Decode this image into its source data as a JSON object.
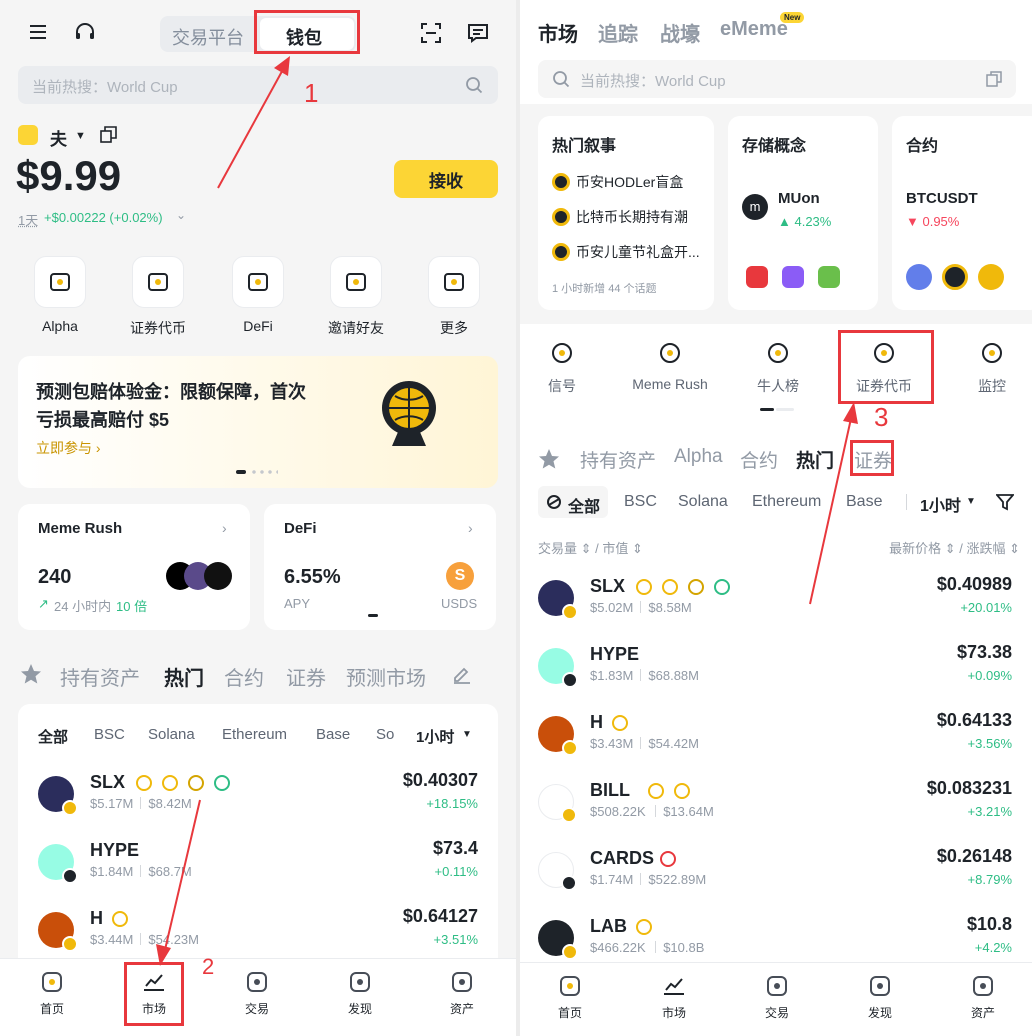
{
  "left": {
    "header": {
      "tab_exchange": "交易平台",
      "tab_wallet": "钱包"
    },
    "search": {
      "placeholder": "当前热搜：World Cup"
    },
    "account": {
      "name": "夫",
      "balance": "$9.99",
      "period": "1天",
      "change": "+$0.00222 (+0.02%)",
      "receive": "接收"
    },
    "shortcuts": [
      {
        "label": "Alpha",
        "icon": "alpha-icon"
      },
      {
        "label": "证券代币",
        "icon": "securities-token-icon"
      },
      {
        "label": "DeFi",
        "icon": "defi-icon"
      },
      {
        "label": "邀请好友",
        "icon": "invite-friends-icon"
      },
      {
        "label": "更多",
        "icon": "more-icon"
      }
    ],
    "banner": {
      "line1": "预测包赔体验金：限额保障，首次",
      "line2": "亏损最高赔付 $5",
      "link": "立即参与 ›"
    },
    "cards": {
      "meme": {
        "title": "Meme Rush",
        "value": "240",
        "sub_prefix": "24 小时内",
        "sub_highlight": "10 倍"
      },
      "defi": {
        "title": "DeFi",
        "value": "6.55%",
        "sub": "APY",
        "token": "USDS"
      }
    },
    "market_tabs": [
      "持有资产",
      "热门",
      "合约",
      "证券",
      "预测市场"
    ],
    "chain_tabs": [
      "全部",
      "BSC",
      "Solana",
      "Ethereum",
      "Base",
      "So"
    ],
    "timeframe": "1小时",
    "tokens": [
      {
        "name": "SLX",
        "vol": "$5.17M",
        "mcap": "$8.42M",
        "price": "$0.40307",
        "change": "+18.15%"
      },
      {
        "name": "HYPE",
        "vol": "$1.84M",
        "mcap": "$68.7M",
        "price": "$73.4",
        "change": "+0.11%"
      },
      {
        "name": "H",
        "vol": "$3.44M",
        "mcap": "$54.23M",
        "price": "$0.64127",
        "change": "+3.51%"
      }
    ],
    "bottom_nav": [
      "首页",
      "市场",
      "交易",
      "发现",
      "资产"
    ],
    "annotations": [
      "1",
      "2"
    ]
  },
  "right": {
    "top_tabs": [
      "市场",
      "追踪",
      "战壕",
      "eMeme"
    ],
    "new_badge": "New",
    "search": {
      "placeholder": "当前热搜：World Cup"
    },
    "cards": {
      "hot": {
        "title": "热门叙事",
        "items": [
          "币安HODLer盲盒",
          "比特币长期持有潮",
          "币安儿童节礼盒开..."
        ],
        "footer": "1 小时新增 44 个话题"
      },
      "storage": {
        "title": "存储概念",
        "token": "MUon",
        "change": "▲ 4.23%"
      },
      "contract": {
        "title": "合约",
        "token": "BTCUSDT",
        "change": "▼ 0.95%"
      }
    },
    "feature_icons": [
      {
        "label": "信号",
        "icon": "signal-icon"
      },
      {
        "label": "Meme Rush",
        "icon": "meme-rush-icon"
      },
      {
        "label": "牛人榜",
        "icon": "leaderboard-icon"
      },
      {
        "label": "证券代币",
        "icon": "securities-token-icon"
      },
      {
        "label": "监控",
        "icon": "monitor-icon"
      }
    ],
    "market_tabs": [
      "持有资产",
      "Alpha",
      "合约",
      "热门",
      "证券"
    ],
    "chain_tabs": [
      "全部",
      "BSC",
      "Solana",
      "Ethereum",
      "Base"
    ],
    "timeframe": "1小时",
    "sort_left": "交易量 ⇕ / 市值 ⇕",
    "sort_right": "最新价格 ⇕ / 涨跌幅 ⇕",
    "tokens": [
      {
        "name": "SLX",
        "vol": "$5.02M",
        "mcap": "$8.58M",
        "price": "$0.40989",
        "change": "+20.01%"
      },
      {
        "name": "HYPE",
        "vol": "$1.83M",
        "mcap": "$68.88M",
        "price": "$73.38",
        "change": "+0.09%"
      },
      {
        "name": "H",
        "vol": "$3.43M",
        "mcap": "$54.42M",
        "price": "$0.64133",
        "change": "+3.56%"
      },
      {
        "name": "BILL",
        "vol": "$508.22K",
        "mcap": "$13.64M",
        "price": "$0.083231",
        "change": "+3.21%"
      },
      {
        "name": "CARDS",
        "vol": "$1.74M",
        "mcap": "$522.89M",
        "price": "$0.26148",
        "change": "+8.79%"
      },
      {
        "name": "LAB",
        "vol": "$466.22K",
        "mcap": "$10.8B",
        "price": "$10.8",
        "change": "+4.2%"
      }
    ],
    "bottom_nav": [
      "首页",
      "市场",
      "交易",
      "发现",
      "资产"
    ],
    "annotations": [
      "3"
    ]
  },
  "colors": {
    "brand_yellow": "#fcd535",
    "up_green": "#2ebd85",
    "down_red": "#f6465d",
    "annotation_red": "#e8383d"
  }
}
